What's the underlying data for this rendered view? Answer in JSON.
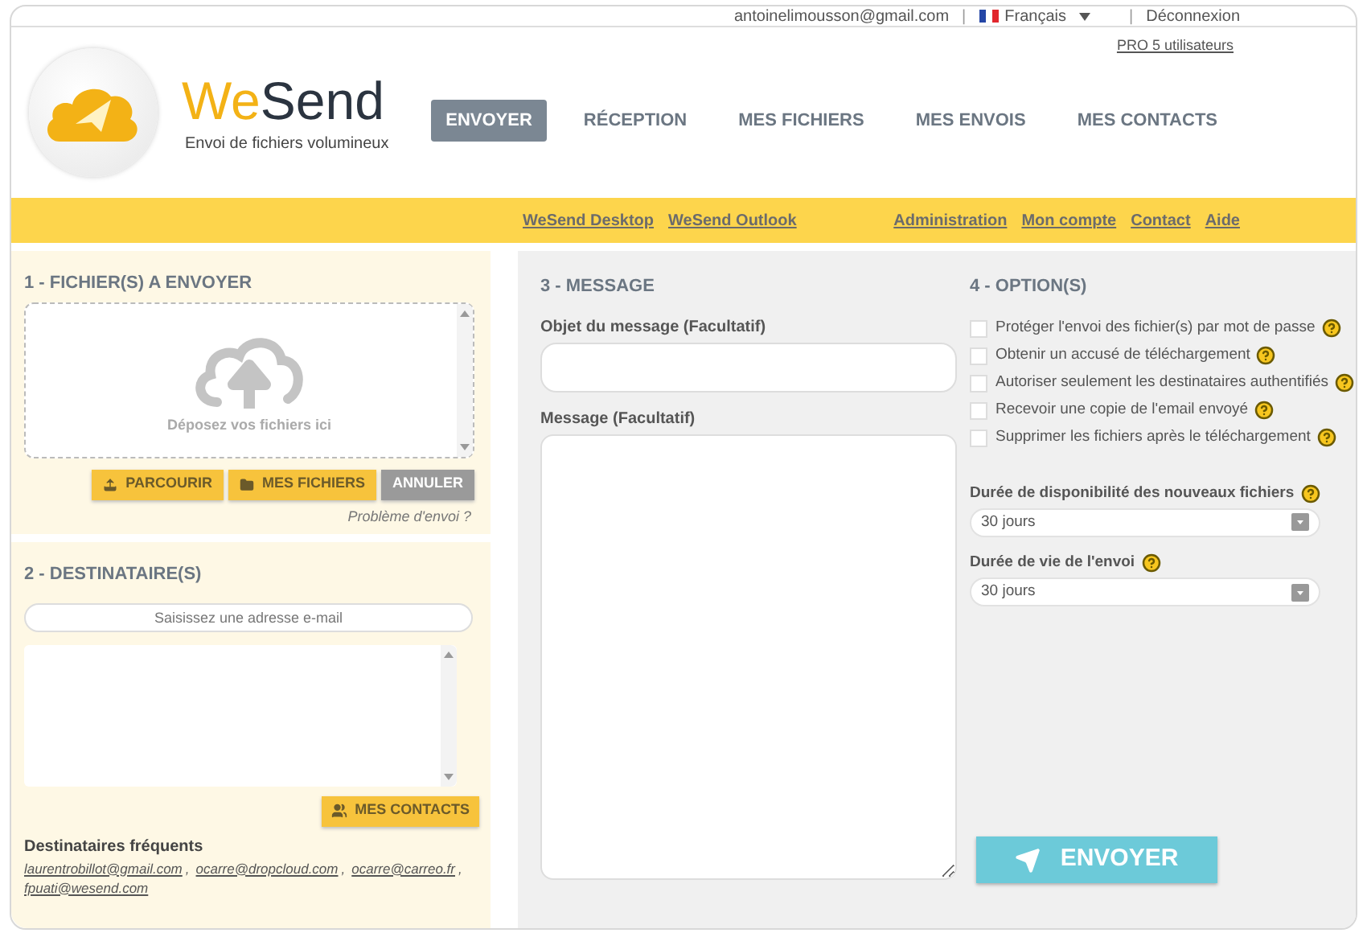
{
  "top_bar": {
    "email": "antoinelimousson@gmail.com",
    "language": "Français",
    "logout": "Déconnexion",
    "separators": [
      "|",
      "|"
    ]
  },
  "plan_link": "PRO 5 utilisateurs",
  "logo": {
    "name_start": "We",
    "name_end": "Send",
    "tagline": "Envoi de fichiers volumineux"
  },
  "main_nav": [
    {
      "label": "ENVOYER",
      "selected": true
    },
    {
      "label": "RÉCEPTION",
      "selected": false
    },
    {
      "label": "MES FICHIERS",
      "selected": false
    },
    {
      "label": "MES ENVOIS",
      "selected": false
    },
    {
      "label": "MES CONTACTS",
      "selected": false
    }
  ],
  "sub_nav_left": [
    "WeSend Desktop",
    "WeSend Outlook"
  ],
  "sub_nav_right": [
    "Administration",
    "Mon compte",
    "Contact",
    "Aide"
  ],
  "files_section": {
    "title": "1 - FICHIER(S) A ENVOYER",
    "drop_hint": "Déposez vos fichiers ici",
    "buttons": [
      {
        "label": "PARCOURIR",
        "kind": "browse"
      },
      {
        "label": "MES FICHIERS",
        "kind": "folder"
      },
      {
        "label": "ANNULER",
        "kind": "cancel"
      }
    ],
    "help_link": "Problème d'envoi ?"
  },
  "recipients_section": {
    "title": "2 - DESTINATAIRE(S)",
    "email_field": {
      "placeholder": "Saisissez une adresse e-mail"
    },
    "contacts_button": "MES CONTACTS",
    "frequent_title": "Destinataires fréquents",
    "frequent_separator": ",",
    "frequent": [
      "laurentrobillot@gmail.com",
      "ocarre@dropcloud.com",
      "ocarre@carreo.fr",
      "fpuati@wesend.com"
    ]
  },
  "message_section": {
    "title": "3 - MESSAGE",
    "subject_label": "Objet du message (Facultatif)",
    "message_label": "Message (Facultatif)"
  },
  "options_section": {
    "title": "4 - OPTION(S)",
    "options": [
      {
        "label": "Protéger l'envoi des fichier(s) par mot de passe",
        "checked": false
      },
      {
        "label": "Obtenir un accusé de téléchargement",
        "checked": false
      },
      {
        "label": "Autoriser seulement les destinataires authentifiés",
        "checked": false
      },
      {
        "label": "Recevoir une copie de l'email envoyé",
        "checked": false
      },
      {
        "label": "Supprimer les fichiers après le téléchargement",
        "checked": false
      }
    ],
    "selects": [
      {
        "label": "Durée de disponibilité des nouveaux fichiers",
        "value": "30 jours"
      },
      {
        "label": "Durée de vie de l'envoi",
        "value": "30 jours"
      }
    ]
  },
  "send_button": "ENVOYER"
}
